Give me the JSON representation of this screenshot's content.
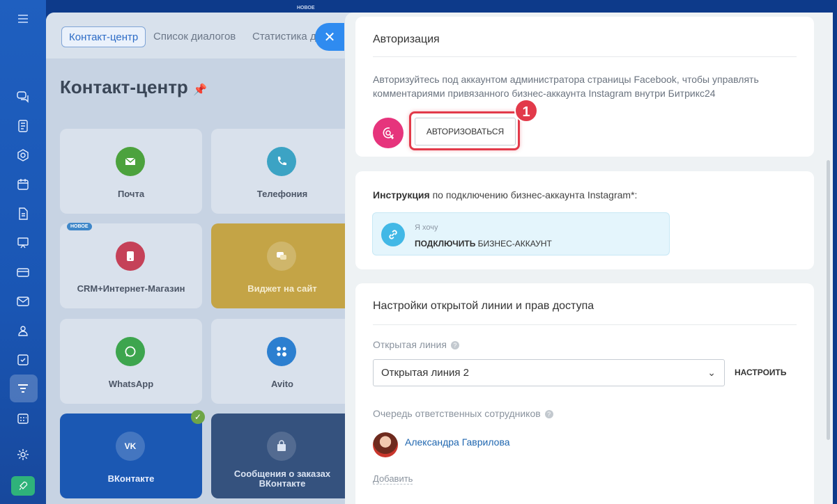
{
  "background": {
    "top_tag": "НОВОЕ",
    "tabs": [
      "Контакт-центр",
      "Список диалогов",
      "Статистика д"
    ],
    "page_title": "Контакт-центр",
    "tiles": {
      "mail": "Почта",
      "phone": "Телефония",
      "crm_shop": "CRM+Интернет-Магазин",
      "widget": "Виджет на сайт",
      "whatsapp": "WhatsApp",
      "avito": "Avito",
      "vk": "ВКонтакте",
      "vk_orders": "Сообщения о заказах ВКонтакте"
    },
    "new_badge": "НОВОЕ"
  },
  "auth": {
    "title": "Авторизация",
    "description": "Авторизуйтесь под аккаунтом администратора страницы Facebook, чтобы управлять комментариями привязанного бизнес-аккаунта Instagram внутри Битрикс24",
    "button_label": "АВТОРИЗОВАТЬСЯ",
    "step_number": "1"
  },
  "instruction": {
    "bold": "Инструкция",
    "text": " по подключению бизнес-аккаунта Instagram*:",
    "link_small": "Я хочу",
    "link_bold": "ПОДКЛЮЧИТЬ",
    "link_rest": " БИЗНЕС-АККАУНТ"
  },
  "settings": {
    "title": "Настройки открытой линии и прав доступа",
    "open_line_label": "Открытая линия",
    "open_line_value": "Открытая линия 2",
    "setup_button": "НАСТРОИТЬ",
    "queue_label": "Очередь ответственных сотрудников",
    "user_name": "Александра Гаврилова",
    "add_link": "Добавить"
  },
  "colors": {
    "accent_red": "#e23a4a",
    "instagram_pink": "#e6347c",
    "link_blue": "#2067b0",
    "rail_blue": "#1f5fbf"
  }
}
